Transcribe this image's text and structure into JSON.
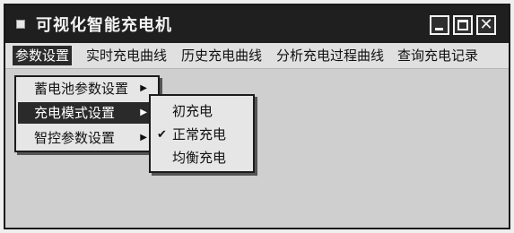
{
  "window": {
    "title": "可视化智能充电机"
  },
  "menubar": {
    "items": [
      {
        "label": "参数设置",
        "active": true
      },
      {
        "label": "实时充电曲线",
        "active": false
      },
      {
        "label": "历史充电曲线",
        "active": false
      },
      {
        "label": "分析充电过程曲线",
        "active": false
      },
      {
        "label": "查询充电记录",
        "active": false
      }
    ]
  },
  "dropdown": {
    "items": [
      {
        "label": "蓄电池参数设置",
        "has_submenu": true,
        "active": false
      },
      {
        "label": "充电模式设置",
        "has_submenu": true,
        "active": true
      },
      {
        "label": "智控参数设置",
        "has_submenu": true,
        "active": false
      }
    ]
  },
  "submenu": {
    "items": [
      {
        "label": "初充电",
        "checked": false
      },
      {
        "label": "正常充电",
        "checked": true
      },
      {
        "label": "均衡充电",
        "checked": false
      }
    ]
  },
  "icons": {
    "app": "app-icon",
    "minimize": "minimize-icon",
    "maximize": "maximize-icon",
    "close": "close-icon",
    "submenu_arrow": "chevron-right-icon",
    "check": "check-icon"
  },
  "colors": {
    "titlebar": "#1f1f1f",
    "highlight": "#2a2a2a",
    "menu_bg": "#e6e6e6"
  }
}
